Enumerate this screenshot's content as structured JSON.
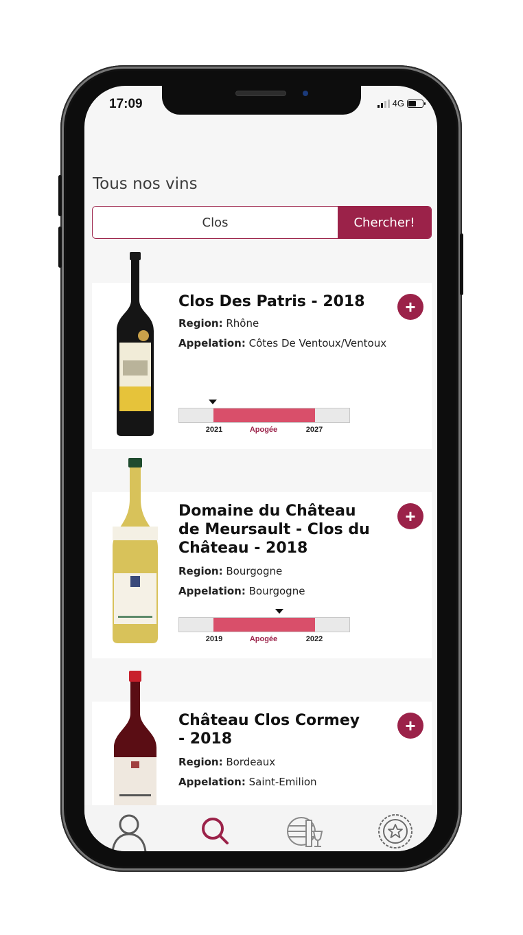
{
  "status_bar": {
    "time": "17:09",
    "network": "4G"
  },
  "page": {
    "title": "Tous nos vins"
  },
  "search": {
    "value": "Clos",
    "button_label": "Chercher!"
  },
  "labels": {
    "region": "Region:",
    "appelation": "Appelation:",
    "apogee": "Apogée"
  },
  "wines": [
    {
      "name": "Clos Des Patris - 2018",
      "region": "Rhône",
      "appelation": "Côtes De Ventoux/Ventoux",
      "timeline": {
        "start": "2021",
        "end": "2027",
        "marker_year": 2021
      }
    },
    {
      "name": "Domaine du Château de Meursault - Clos du Château - 2018",
      "region": "Bourgogne",
      "appelation": "Bourgogne",
      "timeline": {
        "start": "2019",
        "end": "2022",
        "marker_year": 2021
      }
    },
    {
      "name": "Château Clos Cormey - 2018",
      "region": "Bordeaux",
      "appelation": "Saint-Emilion"
    }
  ],
  "tabbar": {
    "items": [
      {
        "icon": "user-icon",
        "active": false
      },
      {
        "icon": "search-icon",
        "active": true
      },
      {
        "icon": "cellar-icon",
        "active": false
      },
      {
        "icon": "badge-star-icon",
        "active": false
      }
    ]
  },
  "colors": {
    "accent": "#9b2249",
    "apogee_fill": "#d94f6a"
  }
}
